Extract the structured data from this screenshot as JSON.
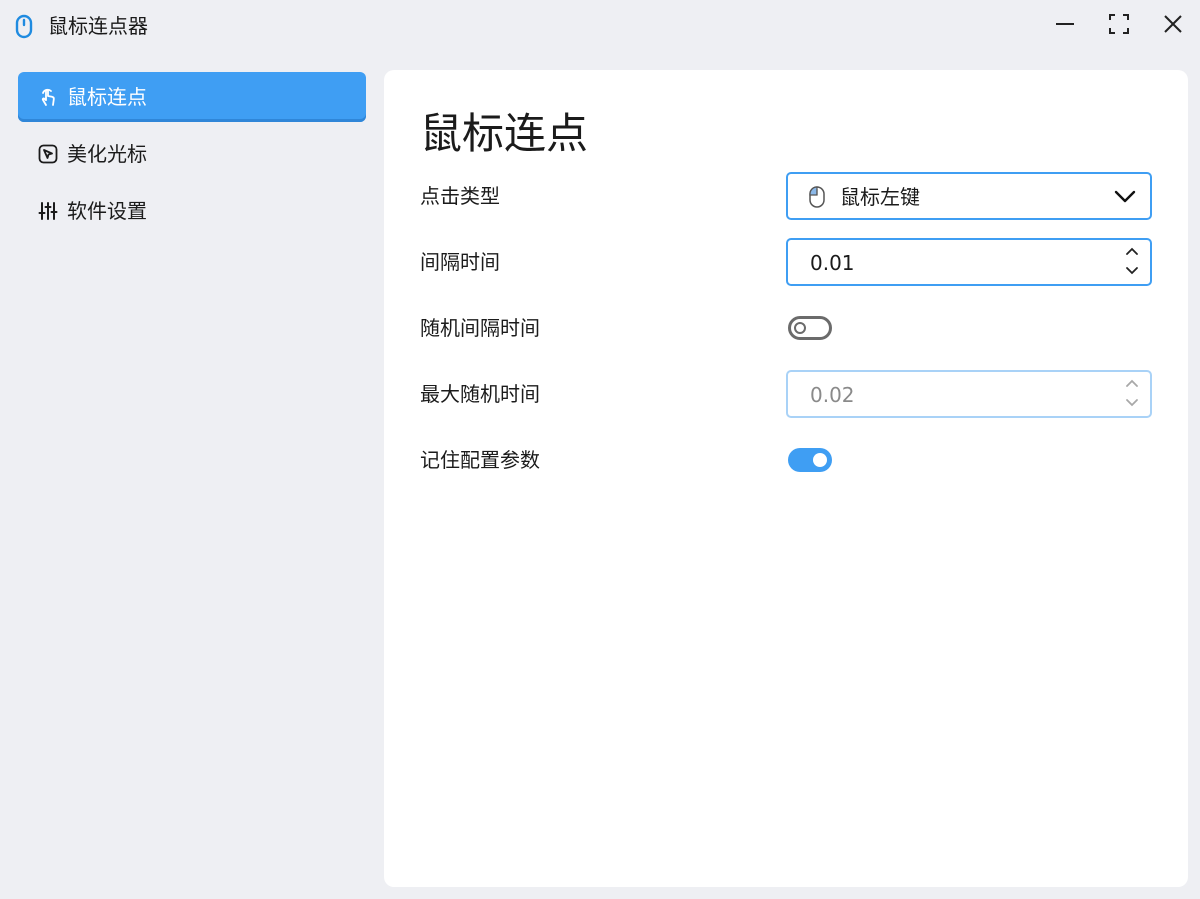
{
  "app": {
    "title": "鼠标连点器"
  },
  "colors": {
    "accent": "#3f9ef3",
    "background": "#eeeff3",
    "card": "#ffffff"
  },
  "sidebar": {
    "items": [
      {
        "label": "鼠标连点",
        "icon": "touch-pointer-icon",
        "active": true
      },
      {
        "label": "美化光标",
        "icon": "cursor-square-icon",
        "active": false
      },
      {
        "label": "软件设置",
        "icon": "sliders-icon",
        "active": false
      }
    ]
  },
  "main": {
    "title": "鼠标连点",
    "rows": {
      "click_type": {
        "label": "点击类型",
        "value": "鼠标左键",
        "icon": "mouse-left-button-icon"
      },
      "interval": {
        "label": "间隔时间",
        "value": "0.01"
      },
      "random_interval": {
        "label": "随机间隔时间",
        "enabled": false
      },
      "max_random": {
        "label": "最大随机时间",
        "value": "0.02",
        "disabled": true
      },
      "remember": {
        "label": "记住配置参数",
        "enabled": true
      }
    }
  }
}
